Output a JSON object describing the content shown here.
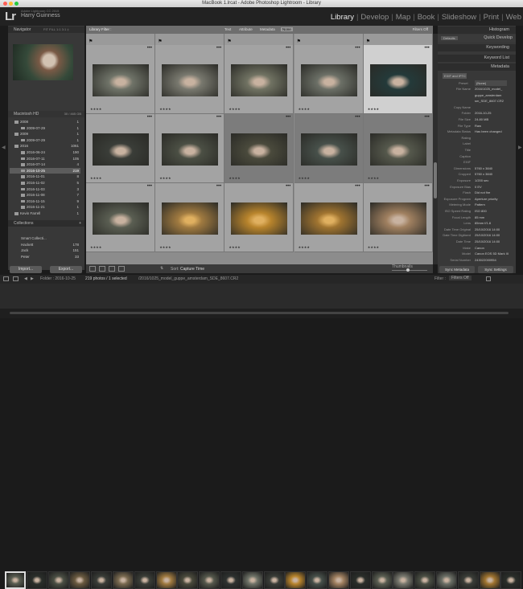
{
  "window": {
    "title": "MacBook 1.lrcat - Adobe Photoshop Lightroom - Library"
  },
  "identity": {
    "catalog_line": "Adobe Lightroom CC 2015",
    "user": "Harry Guinness",
    "logo": "Lr"
  },
  "modules": [
    "Library",
    "Develop",
    "Map",
    "Book",
    "Slideshow",
    "Print",
    "Web"
  ],
  "left_panel": {
    "navigator": {
      "title": "Navigator",
      "zoom": [
        "FIT",
        "FILL",
        "1:1",
        "3:1"
      ]
    },
    "volume": {
      "name": "Macintosh HD",
      "size": "30 / 465 GB"
    },
    "folders": [
      {
        "name": "2008",
        "count": "1"
      },
      {
        "name": "2009-07-29",
        "count": "1"
      },
      {
        "name": "2009",
        "count": "1"
      },
      {
        "name": "2009-07-29",
        "count": "1"
      },
      {
        "name": "2016",
        "count": "1061"
      },
      {
        "name": "2016-06-24",
        "count": "190"
      },
      {
        "name": "2016-07-11",
        "count": "105"
      },
      {
        "name": "2016-07-14",
        "count": "4"
      },
      {
        "name": "2016-10-25",
        "count": "219"
      },
      {
        "name": "2016-11-01",
        "count": "8"
      },
      {
        "name": "2016-11-02",
        "count": "5"
      },
      {
        "name": "2016-11-03",
        "count": "3"
      },
      {
        "name": "2016-11-08",
        "count": "7"
      },
      {
        "name": "2016-11-15",
        "count": "9"
      },
      {
        "name": "2016-11-21",
        "count": "1"
      },
      {
        "name": "Kevin Farrell",
        "count": "1"
      }
    ],
    "collections_title": "Collections",
    "collections": [
      {
        "name": "Smart Collecti...",
        "count": ""
      },
      {
        "name": "Hackett",
        "count": "178"
      },
      {
        "name": "Jack",
        "count": "151"
      },
      {
        "name": "Peter",
        "count": "33"
      }
    ],
    "import_label": "Import...",
    "export_label": "Export..."
  },
  "filter_bar": {
    "title": "Library Filter :",
    "options": [
      "Text",
      "Attribute",
      "Metadata",
      "None"
    ],
    "active": "None",
    "filters_off": "Filters Off"
  },
  "grid": {
    "rows": [
      [
        "flag",
        "flag",
        "flag",
        "flag",
        "flag"
      ],
      [
        "",
        "",
        "",
        "",
        "selected"
      ],
      [
        "",
        "",
        "",
        "",
        ""
      ],
      [
        "",
        "",
        "",
        "",
        ""
      ]
    ]
  },
  "grid_toolbar": {
    "sort_label": "Sort:",
    "sort_value": "Capture Time",
    "thumbnails_label": "Thumbnails"
  },
  "right_panel": {
    "histogram": "Histogram",
    "quick_develop": "Quick Develop",
    "keywording": "Keywording",
    "keyword_list": "Keyword List",
    "metadata": "Metadata",
    "defaults": "Defaults",
    "exif_preset": "EXIF and IPTC",
    "preset_label": "Preset",
    "preset_value": "(None)",
    "meta": [
      {
        "k": "File Name",
        "v": "2016/1025_model_"
      },
      {
        "k": "",
        "v": "guppe_amsterdam"
      },
      {
        "k": "",
        "v": "sm_SDE_8607.CR2"
      },
      {
        "k": "Copy Name",
        "v": ""
      },
      {
        "k": "Folder",
        "v": "2016-10-25"
      },
      {
        "k": "File Size",
        "v": "24.80 MB"
      },
      {
        "k": "File Type",
        "v": "Raw"
      },
      {
        "k": "Metadata Status",
        "v": "Has been changed"
      },
      {
        "k": "Rating",
        "v": ""
      },
      {
        "k": "Label",
        "v": ""
      },
      {
        "k": "Title",
        "v": ""
      },
      {
        "k": "Caption",
        "v": ""
      },
      {
        "k": "EXIF",
        "v": ""
      },
      {
        "k": "Dimensions",
        "v": "5760 x 3840"
      },
      {
        "k": "Cropped",
        "v": "5760 x 3840"
      },
      {
        "k": "Exposure",
        "v": "1/200 sec"
      },
      {
        "k": "Exposure Bias",
        "v": "0 EV"
      },
      {
        "k": "Flash",
        "v": "Did not fire"
      },
      {
        "k": "Exposure Program",
        "v": "Aperture priority"
      },
      {
        "k": "Metering Mode",
        "v": "Pattern"
      },
      {
        "k": "ISO Speed Rating",
        "v": "ISO 800"
      },
      {
        "k": "Focal Length",
        "v": "85 mm"
      },
      {
        "k": "Lens",
        "v": "85mm f/1.8"
      },
      {
        "k": "Date Time Original",
        "v": "25/10/2016 14:00"
      },
      {
        "k": "Date Time Digitized",
        "v": "25/10/2016 14:00"
      },
      {
        "k": "Date Time",
        "v": "25/10/2016 14:00"
      },
      {
        "k": "Make",
        "v": "Canon"
      },
      {
        "k": "Model",
        "v": "Canon EOS 5D Mark III"
      },
      {
        "k": "Serial Number",
        "v": "243022000954"
      }
    ],
    "sync_metadata": "Sync Metadata",
    "sync_settings": "Sync Settings"
  },
  "filmstrip": {
    "breadcrumb": "Folder : 2016-10-25",
    "count": "219 photos / 1 selected",
    "file": "/2016/1025_model_guppe_amsterdam_SDE_8607.CR2",
    "filter_label": "Filter :",
    "filter_value": "Filters Off"
  },
  "colors": {
    "accent": "#e8e8e8",
    "panel": "#383838",
    "grid": "#8c8c8c",
    "selected": "#d0d0d0"
  }
}
